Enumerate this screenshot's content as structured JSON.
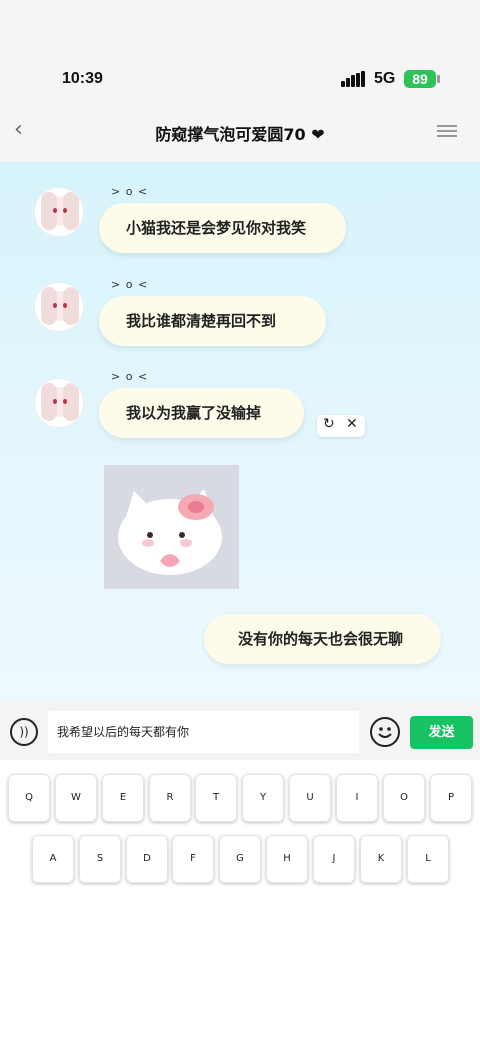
{
  "status_bar": {
    "time": "10:39",
    "network": "5G",
    "battery": "89"
  },
  "header": {
    "title": "防窥撑气泡可爱圆70 ❤"
  },
  "messages": [
    {
      "kaomoji": "> o <",
      "text": "小猫我还是会梦见你对我笑"
    },
    {
      "kaomoji": "> o <",
      "text": "我比谁都清楚再回不到"
    },
    {
      "kaomoji": "> o <",
      "text": "我以为我赢了没输掉"
    },
    {
      "text": "没有你的每天也会很无聊"
    }
  ],
  "message_actions": {
    "retry_icon": "↻",
    "close_icon": "✕"
  },
  "input": {
    "value": "我希望以后的每天都有你",
    "send_label": "发送"
  },
  "keyboard": {
    "row1": [
      "Q",
      "W",
      "E",
      "R",
      "T",
      "Y",
      "U",
      "I",
      "O",
      "P"
    ],
    "row2": [
      "A",
      "S",
      "D",
      "F",
      "G",
      "H",
      "J",
      "K",
      "L"
    ]
  }
}
